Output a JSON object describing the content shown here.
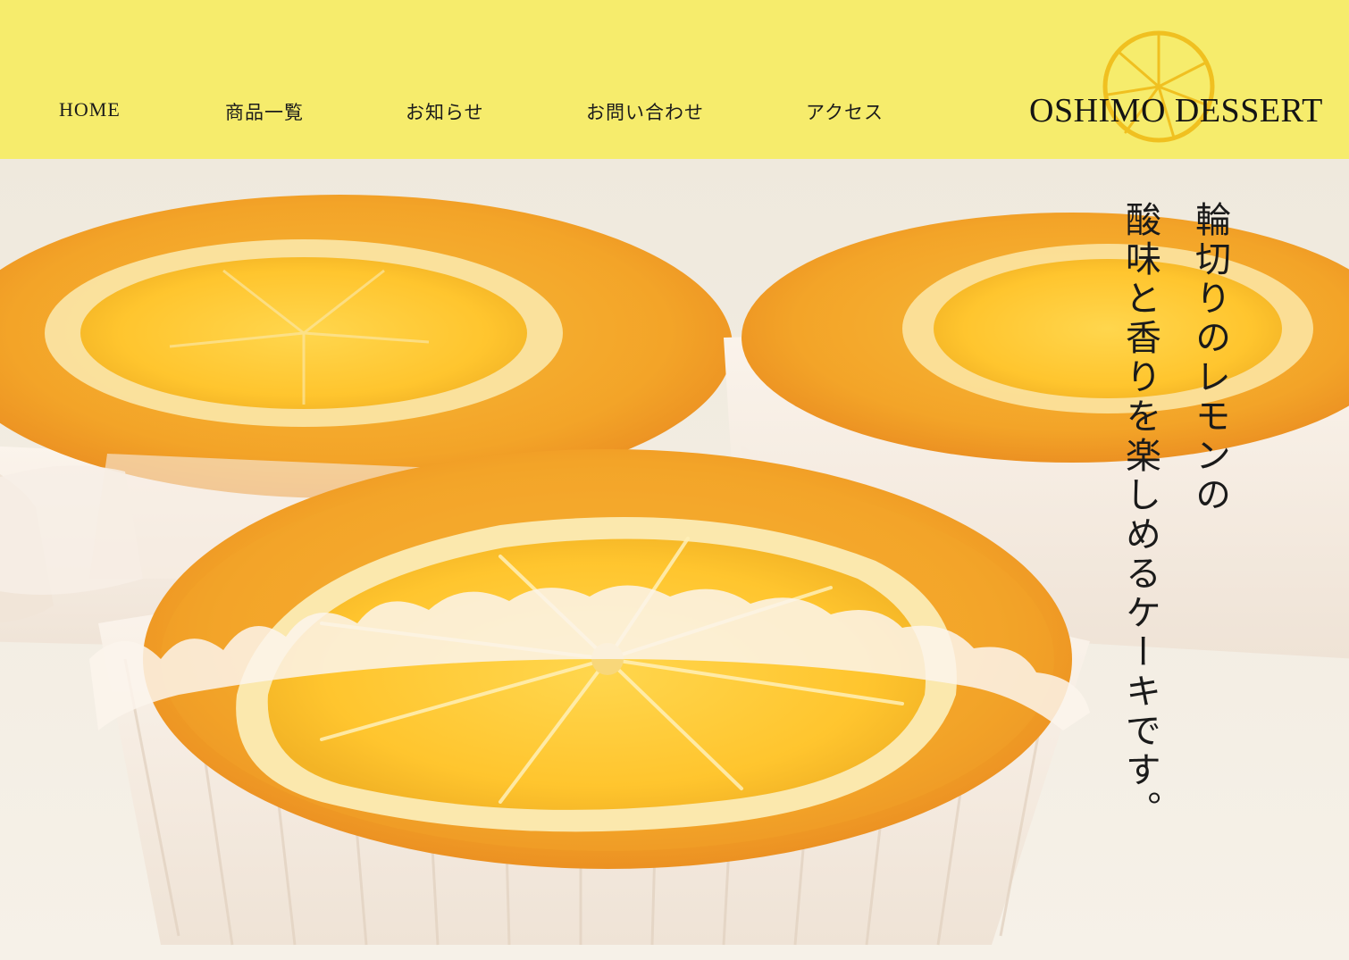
{
  "nav": {
    "home": "HOME",
    "products": "商品一覧",
    "news": "お知らせ",
    "contact": "お問い合わせ",
    "access": "アクセス"
  },
  "logo": {
    "text": "OSHIMO DESSERT",
    "icon": "lemon-slice-icon",
    "icon_color": "#f0c020"
  },
  "hero": {
    "image": "lemon-cakes-photo",
    "tagline_line1": "輪切りのレモンの",
    "tagline_line2": "酸味と香りを楽しめるケーキです。"
  },
  "colors": {
    "header_bg": "#f6ec6c",
    "text": "#1a1a1a"
  }
}
